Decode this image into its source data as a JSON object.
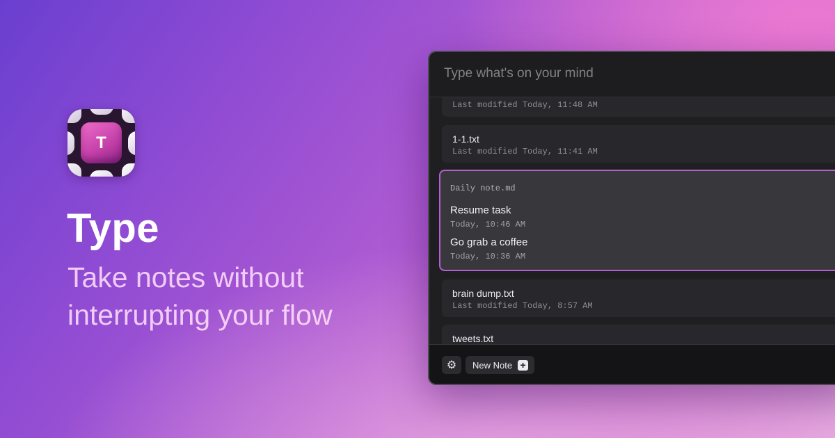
{
  "app": {
    "logo_letter": "T",
    "name": "Type",
    "tagline": "Take notes without interrupting your flow"
  },
  "window": {
    "search": {
      "placeholder": "Type what's on your mind"
    },
    "notes": [
      {
        "name": "",
        "meta": "Last modified Today, 11:48 AM"
      },
      {
        "name": "1-1.txt",
        "meta": "Last modified Today, 11:41 AM"
      },
      {
        "name": "brain dump.txt",
        "meta": "Last modified Today, 8:57 AM"
      },
      {
        "name": "tweets.txt",
        "meta": ""
      }
    ],
    "selected": {
      "file": "Daily note.md",
      "tasks": [
        {
          "title": "Resume task",
          "time": "Today, 10:46 AM"
        },
        {
          "title": "Go grab a coffee",
          "time": "Today, 10:36 AM"
        }
      ]
    },
    "footer": {
      "settings_icon": "gear-icon",
      "new_note_label": "New Note",
      "new_note_icon": "plus-icon"
    }
  },
  "colors": {
    "accent": "#b65ed4",
    "window_bg": "#1f1f22"
  }
}
